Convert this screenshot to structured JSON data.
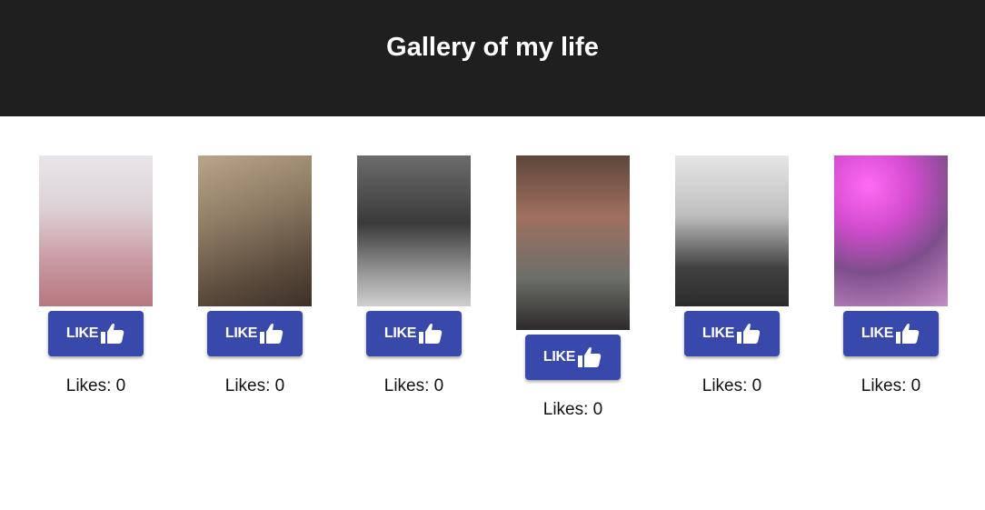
{
  "header": {
    "title": "Gallery of my life"
  },
  "gallery": {
    "items": [
      {
        "photo": "couple-photo-icon",
        "button_label": "LIKE",
        "likes_text": "Likes: 0",
        "likes": 0
      },
      {
        "photo": "pug-photo-icon",
        "button_label": "LIKE",
        "likes_text": "Likes: 0",
        "likes": 0
      },
      {
        "photo": "pug-bw-photo-icon",
        "button_label": "LIKE",
        "likes_text": "Likes: 0",
        "likes": 0
      },
      {
        "photo": "couple-with-pug-photo-icon",
        "button_label": "LIKE",
        "likes_text": "Likes: 0",
        "likes": 0
      },
      {
        "photo": "couple-winter-photo-icon",
        "button_label": "LIKE",
        "likes_text": "Likes: 0",
        "likes": 0
      },
      {
        "photo": "couple-selfie-photo-icon",
        "button_label": "LIKE",
        "likes_text": "Likes: 0",
        "likes": 0
      }
    ]
  },
  "colors": {
    "header_bg": "#1f1f1f",
    "button_bg": "#3949ab",
    "button_text": "#ffffff"
  }
}
